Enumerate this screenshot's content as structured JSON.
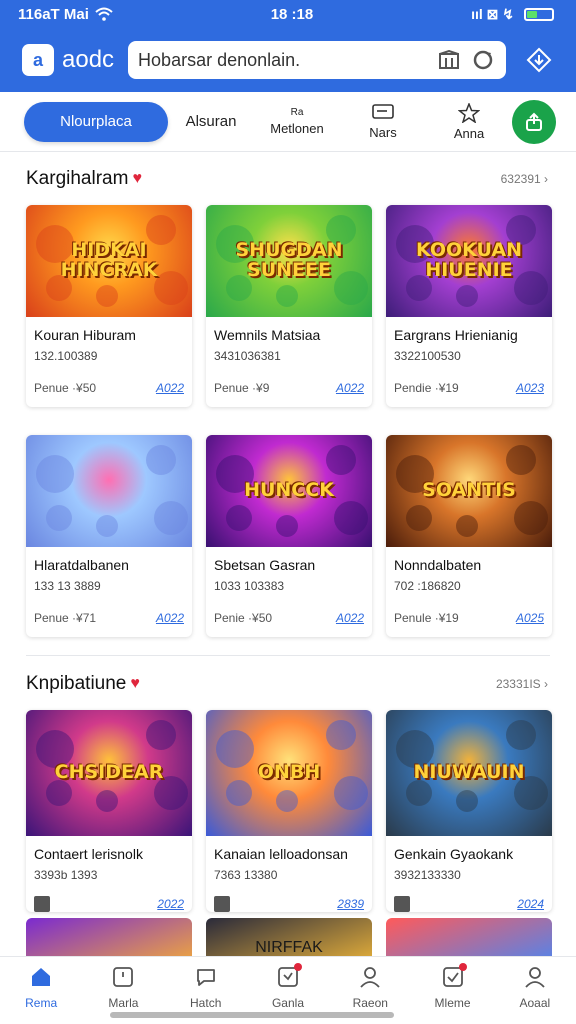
{
  "status": {
    "time_left": "116aT Mai",
    "clock": "18 :18",
    "icons_right": "ııl  ⊠  ↯"
  },
  "header": {
    "logo_text": "aodc",
    "logo_letter": "a",
    "search_placeholder": "Hobarsar denonlain."
  },
  "tabs": {
    "primary": "Nlourplaca",
    "items": [
      {
        "label": "Alsuran",
        "sub": ""
      },
      {
        "label": "Metlonen",
        "sub": "Ra"
      },
      {
        "label": "Nars",
        "sub": ""
      },
      {
        "label": "Anna",
        "sub": ""
      }
    ]
  },
  "sections": [
    {
      "title": "Kargihalram",
      "count": "632391 ›",
      "cards": [
        {
          "art": "HIDKAI\nHINCRAK",
          "name": "Kouran Hiburam",
          "num": "132.100389",
          "label": "Penue ·¥50",
          "year": "A022",
          "c1": "#ff9a1f",
          "c2": "#d9401a",
          "c3": "#ffd84a"
        },
        {
          "art": "SHUGDAN\nSUNEEE",
          "name": "Wemnils Matsiaa",
          "num": "3431036381",
          "label": "Penue ·¥9",
          "year": "A022",
          "c1": "#7fd03a",
          "c2": "#2aa84a",
          "c3": "#ffe04a"
        },
        {
          "art": "KOOKUAN\nHIUENIE",
          "name": "Eargrans Hrienianig",
          "num": "3322100530",
          "label": "Pendie ·¥19",
          "year": "A023",
          "c1": "#a33fd1",
          "c2": "#3d1d78",
          "c3": "#ff7a2a"
        },
        {
          "art": "",
          "name": "Hlaratdalbanen",
          "num": "133 13 3889",
          "label": "Penue ·¥71",
          "year": "A022",
          "c1": "#9ec8ff",
          "c2": "#6a86e0",
          "c3": "#ff6fb2"
        },
        {
          "art": "HUNCCK",
          "name": "Sbetsan Gasran",
          "num": "1033 103383",
          "label": "Penie ·¥50",
          "year": "A022",
          "c1": "#c02ad0",
          "c2": "#381070",
          "c3": "#ffc43a"
        },
        {
          "art": "SOANTIS",
          "name": "Nonndalbaten",
          "num": "702 :186820",
          "label": "Penule ·¥19",
          "year": "A025",
          "c1": "#d8752a",
          "c2": "#4a1c0a",
          "c3": "#ffd87a"
        }
      ]
    },
    {
      "title": "Knpibatiune",
      "count": "23331IS ›",
      "cards": [
        {
          "art": "CHSIDEAR",
          "name": "Contaert lerisnolk",
          "num": "3393b 1393",
          "year": "2022",
          "c1": "#d13a8a",
          "c2": "#3a1478",
          "c3": "#ffc23a"
        },
        {
          "art": "ONBH",
          "name": "Kanaian lelloadonsan",
          "num": "7363 13380",
          "year": "2839",
          "c1": "#ff8a3a",
          "c2": "#3a5ad8",
          "c3": "#ffe27a"
        },
        {
          "art": "NIUWAUIN",
          "name": "Genkain Gyaokank",
          "num": "3932133330",
          "year": "2024",
          "c1": "#3a7abf",
          "c2": "#2a3a4a",
          "c3": "#f2b23a"
        }
      ],
      "peek": [
        {
          "art": "",
          "c1": "#7a2ad0",
          "c2": "#ffb82a"
        },
        {
          "art": "NIRFFAK",
          "c1": "#2a2a3a",
          "c2": "#ffc23a"
        },
        {
          "art": "",
          "c1": "#ff5a5a",
          "c2": "#3a8aff"
        }
      ]
    }
  ],
  "bottom_nav": [
    {
      "label": "Rema",
      "icon": "home-icon",
      "active": true
    },
    {
      "label": "Marla",
      "icon": "grid-icon",
      "active": false
    },
    {
      "label": "Hatch",
      "icon": "chat-icon",
      "active": false
    },
    {
      "label": "Ganla",
      "icon": "gift-icon",
      "active": false
    },
    {
      "label": "Raeon",
      "icon": "user-icon",
      "active": false
    },
    {
      "label": "Mleme",
      "icon": "inbox-icon",
      "active": false
    },
    {
      "label": "Aoaal",
      "icon": "account-icon",
      "active": false
    }
  ],
  "colors": {
    "brand": "#2f6bdf",
    "accent_green": "#1aa34a",
    "heart": "#e0263c"
  }
}
